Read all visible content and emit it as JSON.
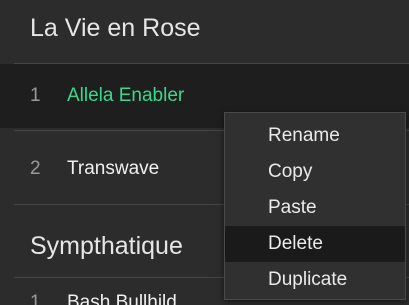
{
  "bank_1": {
    "title": "La Vie en Rose",
    "presets": [
      {
        "number": "1",
        "name": "Allela Enabler",
        "selected": true
      },
      {
        "number": "2",
        "name": "Transwave",
        "selected": false
      }
    ]
  },
  "bank_2": {
    "title": "Sympthatique",
    "presets": [
      {
        "number": "1",
        "name": "Bash Bullhild"
      }
    ]
  },
  "context_menu": {
    "items": [
      "Rename",
      "Copy",
      "Paste",
      "Delete",
      "Duplicate"
    ],
    "highlighted": "Delete"
  },
  "colors": {
    "selected_text": "#38d98d",
    "background": "#2c2c2c",
    "selected_row_bg": "#1e1e1e",
    "menu_bg": "#303030",
    "menu_highlight": "#1a1a1a"
  }
}
